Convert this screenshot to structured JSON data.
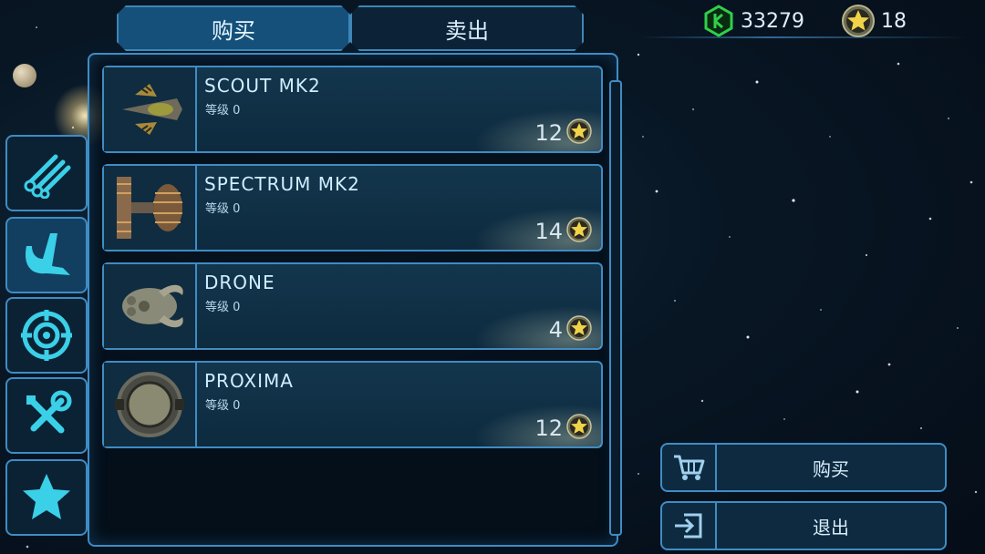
{
  "tabs": {
    "buy": "购买",
    "sell": "卖出"
  },
  "currency": {
    "credits": "33279",
    "stars": "18"
  },
  "items": [
    {
      "name": "SCOUT MK2",
      "level": "等级 0",
      "price": "12"
    },
    {
      "name": "SPECTRUM MK2",
      "level": "等级 0",
      "price": "14"
    },
    {
      "name": "DRONE",
      "level": "等级 0",
      "price": "4"
    },
    {
      "name": "PROXIMA",
      "level": "等级 0",
      "price": "12"
    }
  ],
  "side_nav": [
    {
      "icon": "pipes-icon"
    },
    {
      "icon": "ship-hull-icon"
    },
    {
      "icon": "target-icon"
    },
    {
      "icon": "tools-icon"
    },
    {
      "icon": "star-icon"
    }
  ],
  "actions": {
    "buy": "购买",
    "exit": "退出"
  },
  "colors": {
    "border": "#3f8cc4",
    "accent": "#3ad0e8",
    "credit_green": "#2fd04a",
    "coin_gold": "#e8c24a"
  }
}
